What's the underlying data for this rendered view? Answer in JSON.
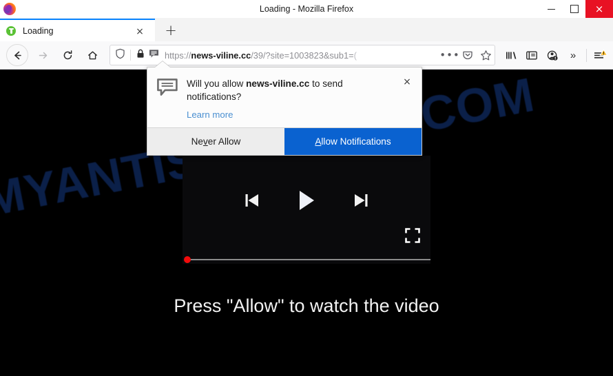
{
  "window": {
    "title": "Loading - Mozilla Firefox",
    "logo_icon": "firefox-logo",
    "minimize_label": "minimize-icon",
    "maximize_label": "maximize-icon",
    "close_label": "×"
  },
  "tabs": {
    "items": [
      {
        "title": "Loading",
        "favicon": "green-circle-favicon",
        "close_label": "×"
      }
    ],
    "new_tab_label": "+"
  },
  "toolbar": {
    "back_icon": "back-arrow-icon",
    "forward_icon": "forward-arrow-icon",
    "reload_icon": "reload-icon",
    "home_icon": "home-icon",
    "shield_icon": "shield-icon",
    "lock_icon": "padlock-icon",
    "notification_icon": "speech-bubble-icon",
    "overflow_label": "•••",
    "pocket_icon": "pocket-icon",
    "bookmark_icon": "star-icon",
    "library_icon": "library-icon",
    "sidebar_icon": "sidebar-icon",
    "account_icon": "account-warning-icon",
    "more_label": "»",
    "menu_icon": "hamburger-menu-icon"
  },
  "address_bar": {
    "scheme": "https://",
    "host": "news-viline.cc",
    "path": "/39/?site=1003823&sub1=",
    "truncated_tail": "(",
    "full_value": "https://news-viline.cc/39/?site=1003823&sub1=("
  },
  "notification_popup": {
    "icon": "speech-bubble-icon",
    "question_prefix": "Will you allow ",
    "question_domain": "news-viline.cc",
    "question_suffix": " to send notifications?",
    "learn_more": "Learn more",
    "close_label": "×",
    "never_allow_pre": "Ne",
    "never_allow_underline": "v",
    "never_allow_post": "er Allow",
    "allow_underline": "A",
    "allow_post": "llow Notifications",
    "accent_color": "#0a62d0"
  },
  "page": {
    "watermark": "MYANTISPYWARE.COM",
    "watermark_color": "#0d2350",
    "tagline": "Press \"Allow\" to watch the video",
    "player": {
      "previous_icon": "skip-previous-icon",
      "play_icon": "play-icon",
      "next_icon": "skip-next-icon",
      "fullscreen_icon": "fullscreen-icon",
      "progress_percent": 0,
      "progress_dot_color": "#f20b0b",
      "background_color": "#0a0a0c"
    }
  }
}
